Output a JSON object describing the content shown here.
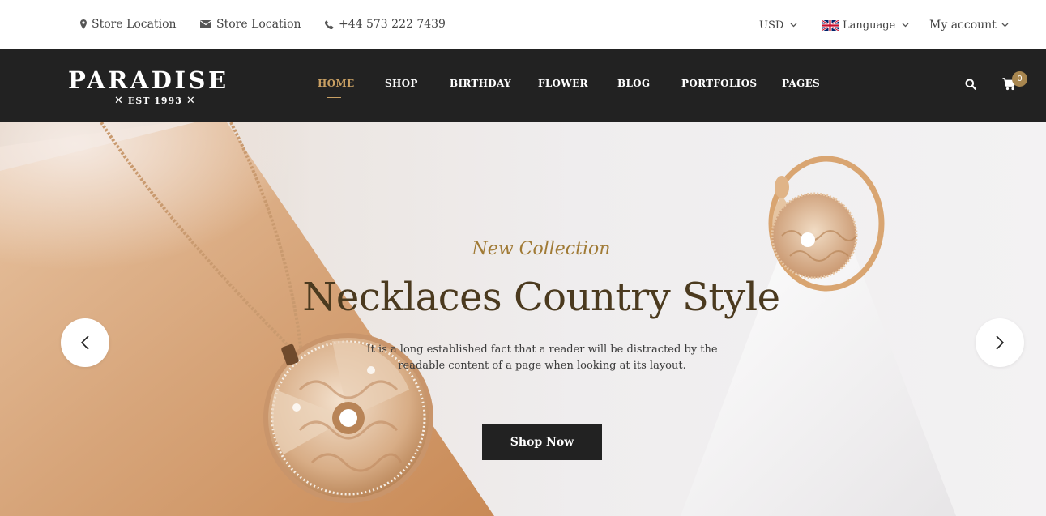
{
  "topbar": {
    "location_1": "Store Location",
    "location_2": "Store Location",
    "phone": "+44 573 222 7439",
    "currency": "USD",
    "language": "Language",
    "account": "My account"
  },
  "header": {
    "logo_title": "PARADISE",
    "logo_subtitle": "EST 1993",
    "nav": [
      "HOME",
      "SHOP",
      "BIRTHDAY",
      "FLOWER",
      "BLOG",
      "PORTFOLIOS",
      "PAGES"
    ],
    "active_nav": "HOME",
    "cart_count": "0"
  },
  "hero": {
    "subtitle": "New Collection",
    "headline": "Necklaces Country Style",
    "description": "It is a long established fact that a reader will be distracted by the readable content of a page when looking at its layout.",
    "button": "Shop Now"
  },
  "icons": {
    "location": "map-marker-icon",
    "email": "envelope-icon",
    "phone": "phone-icon",
    "flag": "uk-flag-icon",
    "search": "search-icon",
    "cart": "cart-icon",
    "prev": "chevron-left-icon",
    "next": "chevron-right-icon"
  },
  "colors": {
    "header_bg": "#222222",
    "accent_gold": "#c9a063",
    "subtitle_gold": "#a07a35",
    "headline_brown": "#4b3a1f",
    "badge": "#a8864f"
  }
}
